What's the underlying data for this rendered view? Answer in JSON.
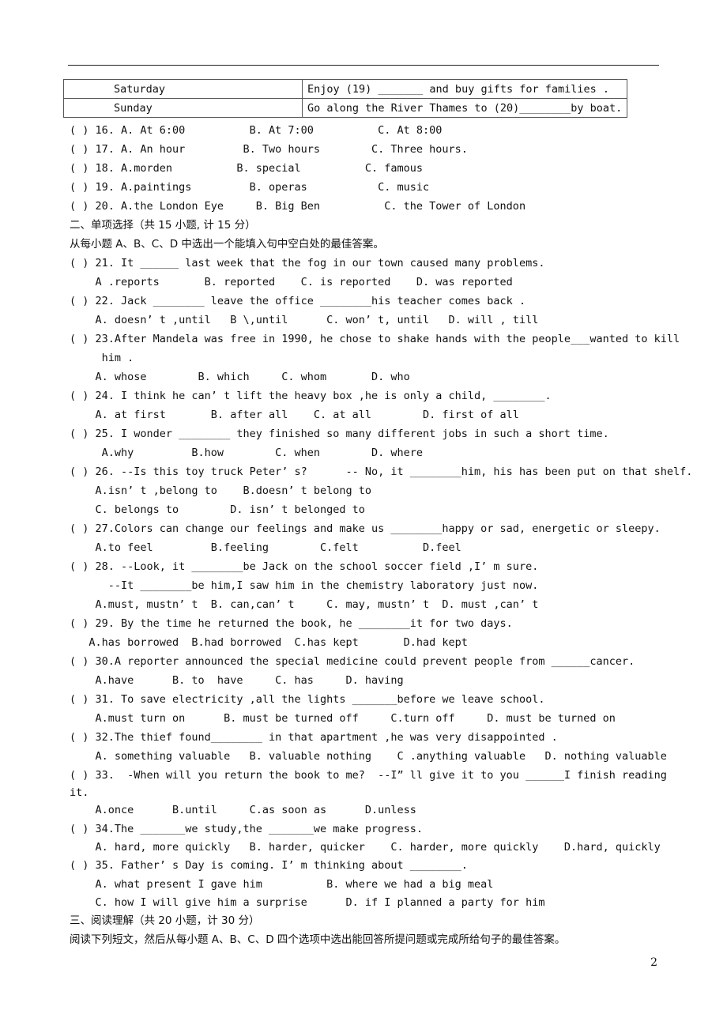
{
  "schedule_table": [
    {
      "day": "Saturday",
      "activity": "Enjoy (19) _______ and buy gifts for families ."
    },
    {
      "day": "Sunday",
      "activity": "Go along the River Thames to (20)________by boat."
    }
  ],
  "listening_questions": [
    "( ) 16. A. At 6:00          B. At 7:00          C. At 8:00",
    "( ) 17. A. An hour         B. Two hours        C. Three hours.",
    "( ) 18. A.morden          B. special          C. famous",
    "( ) 19. A.paintings         B. operas           C. music",
    "( ) 20. A.the London Eye     B. Big Ben          C. the Tower of London"
  ],
  "section2": {
    "heading": "二、单项选择（共 15 小题, 计 15 分）",
    "instruction": "从每小题 A、B、C、D 中选出一个能填入句中空白处的最佳答案。"
  },
  "lines": [
    "( ) 21. It ______ last week that the fog in our town caused many problems.",
    "    A .reports       B. reported    C. is reported    D. was reported",
    "( ) 22. Jack ________ leave the office ________his teacher comes back .",
    "    A. doesn’ t ,until   B \\,until      C. won’ t, until   D. will , till",
    "( ) 23.After Mandela was free in 1990, he chose to shake hands with the people___wanted to kill",
    "     him .",
    "    A. whose        B. which     C. whom       D. who",
    "( ) 24. I think he can’ t lift the heavy box ,he is only a child, ________.",
    "    A. at first       B. after all    C. at all        D. first of all",
    "( ) 25. I wonder ________ they finished so many different jobs in such a short time.",
    "     A.why         B.how        C. when        D. where",
    "( ) 26. --Is this toy truck Peter’ s?      -- No, it ________him, his has been put on that shelf.",
    "    A.isn’ t ,belong to    B.doesn’ t belong to",
    "    C. belongs to        D. isn’ t belonged to",
    "( ) 27.Colors can change our feelings and make us ________happy or sad, energetic or sleepy.",
    "    A.to feel         B.feeling        C.felt          D.feel",
    "( ) 28. --Look, it ________be Jack on the school soccer field ,I’ m sure.",
    "      --It ________be him,I saw him in the chemistry laboratory just now.",
    "    A.must, mustn’ t  B. can,can’ t     C. may, mustn’ t  D. must ,can’ t",
    "( ) 29. By the time he returned the book, he ________it for two days.",
    "   A.has borrowed  B.had borrowed  C.has kept       D.had kept",
    "( ) 30.A reporter announced the special medicine could prevent people from ______cancer.",
    "    A.have      B. to  have     C. has     D. having",
    "( ) 31. To save electricity ,all the lights _______before we leave school.",
    "    A.must turn on      B. must be turned off     C.turn off     D. must be turned on",
    "( ) 32.The thief found________ in that apartment ,he was very disappointed .",
    "    A. something valuable   B. valuable nothing    C .anything valuable   D. nothing valuable",
    "( ) 33.  -When will you return the book to me?  --I” ll give it to you ______I finish reading",
    "it.",
    "    A.once      B.until     C.as soon as      D.unless",
    "( ) 34.The _______we study,the _______we make progress.",
    "    A. hard, more quickly   B. harder, quicker    C. harder, more quickly    D.hard, quickly",
    "( ) 35. Father’ s Day is coming. I’ m thinking about ________.",
    "    A. what present I gave him          B. where we had a big meal",
    "    C. how I will give him a surprise      D. if I planned a party for him"
  ],
  "section3": {
    "heading": "三、阅读理解（共 20 小题，计 30 分）",
    "instruction": "阅读下列短文，然后从每小题 A、B、C、D 四个选项中选出能回答所提问题或完成所给句子的最佳答案。"
  },
  "page_number": "2"
}
